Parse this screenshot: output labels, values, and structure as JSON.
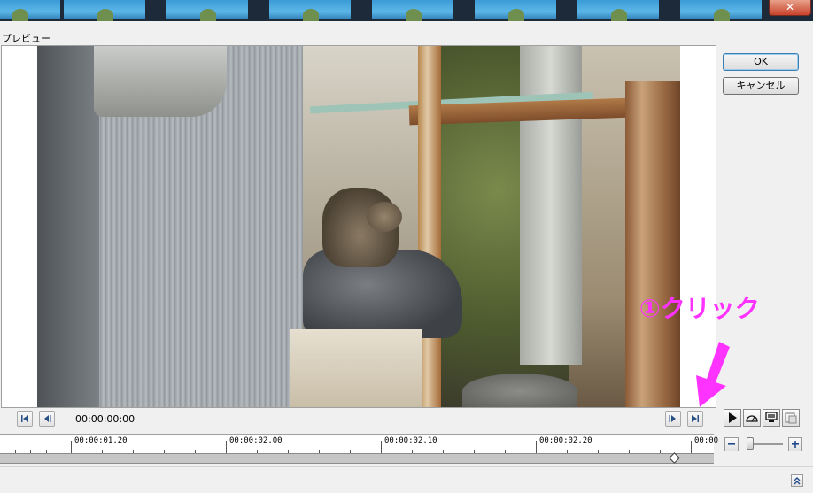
{
  "window": {
    "close_label": "✕",
    "preview_label": "プレビュー"
  },
  "dialog": {
    "ok_label": "OK",
    "cancel_label": "キャンセル"
  },
  "transport": {
    "timecode": "00:00:00:00"
  },
  "timeline": {
    "labels": [
      "00:00:01.20",
      "00:00:02.00",
      "00:00:02.10",
      "00:00:02.20",
      "00:00"
    ]
  },
  "annotation": {
    "text": "①クリック",
    "color": "#ff33ff"
  },
  "colors": {
    "annotation": "#ff33ff",
    "ok_border": "#3c7fb1"
  }
}
